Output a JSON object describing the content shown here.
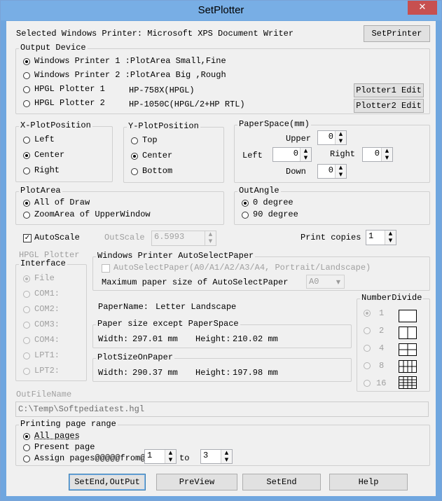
{
  "window": {
    "title": "SetPlotter",
    "close": "✕"
  },
  "printer": {
    "selected_label": "Selected Windows Printer: Microsoft XPS Document Writer",
    "set_button": "SetPrinter"
  },
  "output_device": {
    "title": "Output Device",
    "options": [
      {
        "label": "Windows Printer 1 :PlotArea Small,Fine",
        "selected": true
      },
      {
        "label": "Windows Printer 2 :PlotArea Big  ,Rough",
        "selected": false
      },
      {
        "label": "HPGL Plotter 1",
        "detail": "HP-758X(HPGL)",
        "selected": false,
        "edit": "Plotter1 Edit"
      },
      {
        "label": "HPGL Plotter 2",
        "detail": "HP-1050C(HPGL/2+HP RTL)",
        "selected": false,
        "edit": "Plotter2 Edit"
      }
    ]
  },
  "x_plot_position": {
    "title": "X-PlotPosition",
    "options": [
      "Left",
      "Center",
      "Right"
    ],
    "selected": "Center"
  },
  "y_plot_position": {
    "title": "Y-PlotPosition",
    "options": [
      "Top",
      "Center",
      "Bottom"
    ],
    "selected": "Center"
  },
  "paper_space": {
    "title": "PaperSpace(mm)",
    "upper_label": "Upper",
    "upper": "0",
    "left_label": "Left",
    "left": "0",
    "right_label": "Right",
    "right": "0",
    "down_label": "Down",
    "down": "0"
  },
  "plot_area": {
    "title": "PlotArea",
    "options": [
      "All of Draw",
      "ZoomArea of UpperWindow"
    ],
    "selected": "All of Draw"
  },
  "out_angle": {
    "title": "OutAngle",
    "options": [
      "0 degree",
      "90 degree"
    ],
    "selected": "0 degree"
  },
  "autoscale": {
    "label": "AutoScale",
    "checked": true,
    "outscale_label": "OutScale",
    "outscale_value": "6.5993"
  },
  "print_copies": {
    "label": "Print copies",
    "value": "1"
  },
  "hpgl_plotter": {
    "label": "HPGL Plotter",
    "interface_title": "Interface",
    "options": [
      "File",
      "COM1:",
      "COM2:",
      "COM3:",
      "COM4:",
      "LPT1:",
      "LPT2:"
    ],
    "selected": "File"
  },
  "auto_select_paper": {
    "title": "Windows Printer AutoSelectPaper",
    "checkbox_label": "AutoSelectPaper(A0/A1/A2/A3/A4, Portrait/Landscape)",
    "max_label": "Maximum paper size of AutoSelectPaper",
    "max_value": "A0"
  },
  "paper_name": {
    "label": "PaperName:",
    "value": "Letter Landscape"
  },
  "paper_size": {
    "title": "Paper size except PaperSpace",
    "width_label": "Width:",
    "width": "297.01 mm",
    "height_label": "Height:",
    "height": "210.02 mm"
  },
  "plot_size": {
    "title": "PlotSizeOnPaper",
    "width_label": "Width:",
    "width": "290.37 mm",
    "height_label": "Height:",
    "height": "197.98 mm"
  },
  "number_divide": {
    "title": "NumberDivide",
    "options": [
      "1",
      "2",
      "4",
      "8",
      "16"
    ],
    "selected": "1"
  },
  "out_file": {
    "label": "OutFileName",
    "value": "C:\\Temp\\Softpediatest.hgl"
  },
  "page_range": {
    "title": "Printing page range",
    "options": [
      "All pages",
      "Present page",
      "Assign pages@@@@@from@"
    ],
    "selected": "All pages",
    "from": "1",
    "to_label": "to",
    "to": "3"
  },
  "buttons": {
    "setend_output": "SetEnd,OutPut",
    "preview": "PreView",
    "setend": "SetEnd",
    "help": "Help"
  }
}
